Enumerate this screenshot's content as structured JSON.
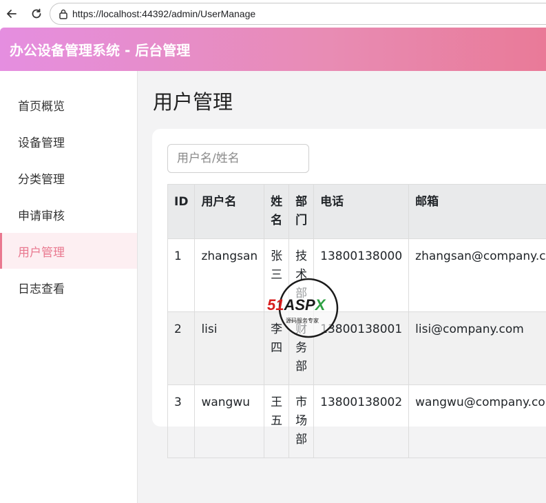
{
  "browser": {
    "url": "https://localhost:44392/admin/UserManage"
  },
  "header": {
    "title": "办公设备管理系统 - 后台管理"
  },
  "sidebar": {
    "items": [
      {
        "label": "首页概览"
      },
      {
        "label": "设备管理"
      },
      {
        "label": "分类管理"
      },
      {
        "label": "申请审核"
      },
      {
        "label": "用户管理"
      },
      {
        "label": "日志查看"
      }
    ],
    "active_index": 4
  },
  "main": {
    "page_title": "用户管理",
    "search_placeholder": "用户名/姓名",
    "search_value": ""
  },
  "table": {
    "headers": [
      "ID",
      "用户名",
      "姓名",
      "部门",
      "电话",
      "邮箱"
    ],
    "rows": [
      [
        "1",
        "zhangsan",
        "张三",
        "技术部",
        "13800138000",
        "zhangsan@company.com"
      ],
      [
        "2",
        "lisi",
        "李四",
        "财务部",
        "13800138001",
        "lisi@company.com"
      ],
      [
        "3",
        "wangwu",
        "王五",
        "市场部",
        "13800138002",
        "wangwu@company.com"
      ]
    ]
  },
  "watermark": {
    "brand": "51ASPX",
    "tagline": "源码服务专家"
  },
  "colors": {
    "accent": "#e9788f",
    "header_start": "#e58ee0",
    "header_end": "#e97a98"
  }
}
